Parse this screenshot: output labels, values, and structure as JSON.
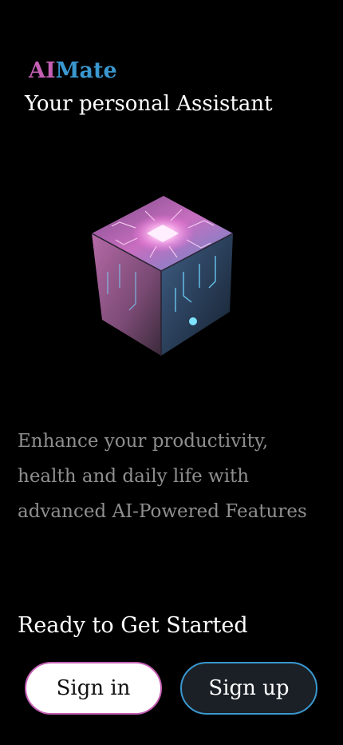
{
  "brand": {
    "ai": "AI",
    "mate": "Mate",
    "ai_color": "#c45fb4",
    "mate_color": "#3a97cf"
  },
  "tagline": "Your personal Assistant",
  "hero": {
    "image": "ai-circuit-cube"
  },
  "description": {
    "line1": "Enhance your productivity,",
    "line2": "health and daily life with",
    "line3": "advanced AI-Powered Features"
  },
  "cta": {
    "heading": "Ready to Get Started",
    "signin_label": "Sign in",
    "signup_label": "Sign up"
  }
}
